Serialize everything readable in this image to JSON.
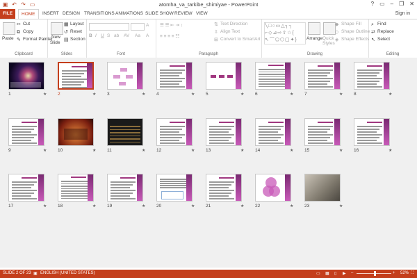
{
  "window": {
    "title": "atomha_va_tarkibe_shimiyae - PowerPoint",
    "controls": [
      "?",
      "▭",
      "–",
      "❐",
      "✕"
    ]
  },
  "qat": {
    "icons": [
      "save-icon",
      "undo-icon",
      "redo-icon",
      "slideshow-icon"
    ]
  },
  "tabs": [
    "FILE",
    "HOME",
    "INSERT",
    "DESIGN",
    "TRANSITIONS",
    "ANIMATIONS",
    "SLIDE SHOW",
    "REVIEW",
    "VIEW"
  ],
  "signin": "Sign in",
  "ribbon": {
    "clipboard": {
      "label": "Clipboard",
      "paste": "Paste",
      "cut": "Cut",
      "copy": "Copy",
      "format_painter": "Format Painter"
    },
    "slides": {
      "label": "Slides",
      "new_slide": "New",
      "new_slide2": "Slide",
      "layout": "Layout",
      "reset": "Reset",
      "section": "Section"
    },
    "font": {
      "label": "Font"
    },
    "paragraph": {
      "label": "Paragraph",
      "text_direction": "Text Direction",
      "align_text": "Align Text",
      "convert": "Convert to SmartArt"
    },
    "drawing": {
      "label": "Drawing",
      "arrange": "Arrange",
      "quick_styles": "Quick",
      "quick_styles2": "Styles",
      "shape_fill": "Shape Fill",
      "shape_outline": "Shape Outline",
      "shape_effects": "Shape Effects"
    },
    "editing": {
      "label": "Editing",
      "find": "Find",
      "replace": "Replace",
      "select": "Select"
    }
  },
  "slides": [
    {
      "n": "1",
      "kind": "cosmic"
    },
    {
      "n": "2",
      "kind": "text",
      "selected": true
    },
    {
      "n": "3",
      "kind": "diagram"
    },
    {
      "n": "4",
      "kind": "text"
    },
    {
      "n": "5",
      "kind": "formula"
    },
    {
      "n": "6",
      "kind": "table"
    },
    {
      "n": "7",
      "kind": "text"
    },
    {
      "n": "8",
      "kind": "text"
    },
    {
      "n": "9",
      "kind": "text"
    },
    {
      "n": "10",
      "kind": "warm"
    },
    {
      "n": "11",
      "kind": "dark"
    },
    {
      "n": "12",
      "kind": "text"
    },
    {
      "n": "13",
      "kind": "text"
    },
    {
      "n": "14",
      "kind": "text"
    },
    {
      "n": "15",
      "kind": "text"
    },
    {
      "n": "16",
      "kind": "text"
    },
    {
      "n": "17",
      "kind": "text"
    },
    {
      "n": "18",
      "kind": "table"
    },
    {
      "n": "19",
      "kind": "text"
    },
    {
      "n": "20",
      "kind": "diagram2"
    },
    {
      "n": "21",
      "kind": "text"
    },
    {
      "n": "22",
      "kind": "venn"
    },
    {
      "n": "23",
      "kind": "photo"
    }
  ],
  "slide_star": "★",
  "status": {
    "slide": "SLIDE 2 OF 23",
    "language": "ENGLISH (UNITED STATES)",
    "zoom": "52%",
    "zoom_fraction": 0.52
  },
  "colors": {
    "accent": "#c43e1c",
    "band": "#a0377f"
  }
}
